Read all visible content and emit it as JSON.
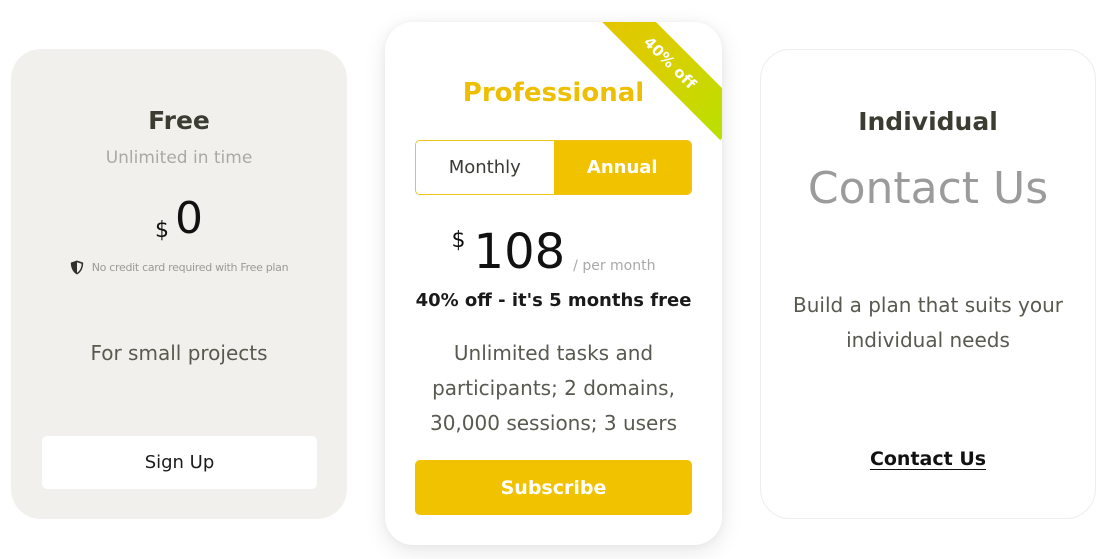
{
  "colors": {
    "accent": "#f0c200",
    "free_card_bg": "#f1f0ec",
    "ribbon_start": "#e5c400",
    "ribbon_end": "#b9e000"
  },
  "plans": {
    "free": {
      "title": "Free",
      "subtitle": "Unlimited in time",
      "currency": "$",
      "price": "0",
      "note_icon": "shield-icon",
      "note": "No credit card required with Free plan",
      "description": "For small projects",
      "button_label": "Sign Up"
    },
    "professional": {
      "ribbon": "40% off",
      "title": "Professional",
      "billing_options": [
        "Monthly",
        "Annual"
      ],
      "selected_billing": "Annual",
      "currency": "$",
      "price": "108",
      "period": "/ per month",
      "offer": "40% off - it's 5 months free",
      "description": "Unlimited tasks and participants; 2 domains, 30,000 sessions; 3 users",
      "button_label": "Subscribe"
    },
    "individual": {
      "title": "Individual",
      "headline": "Contact Us",
      "description": "Build a plan that suits your individual needs",
      "link_label": "Contact Us"
    }
  }
}
